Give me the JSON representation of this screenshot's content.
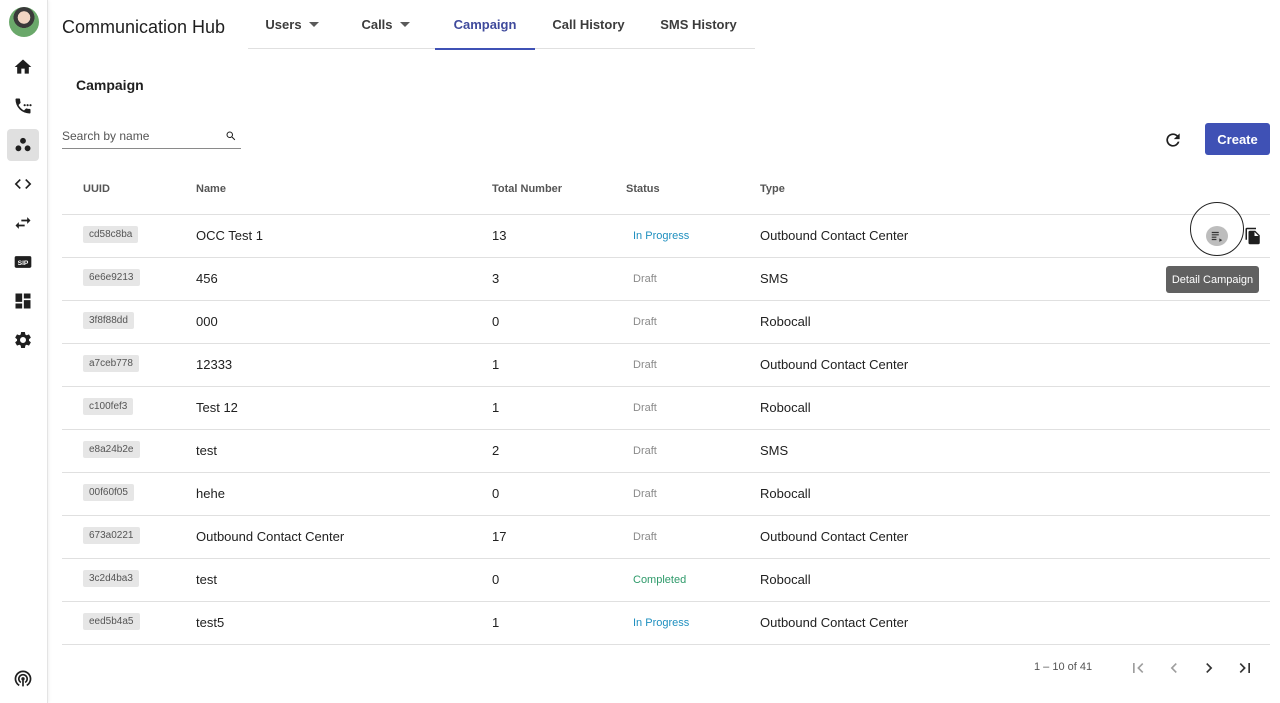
{
  "app": {
    "title": "Communication Hub"
  },
  "sidebar": {
    "items": [
      {
        "name": "home",
        "icon": "home-icon"
      },
      {
        "name": "calls",
        "icon": "phone-dial-icon"
      },
      {
        "name": "campaign",
        "icon": "group-icon",
        "active": true
      },
      {
        "name": "code",
        "icon": "code-icon"
      },
      {
        "name": "transfer",
        "icon": "swap-arrows-icon"
      },
      {
        "name": "sip",
        "icon": "sip-icon",
        "label": "SIP"
      },
      {
        "name": "dashboard",
        "icon": "dashboard-icon"
      },
      {
        "name": "settings",
        "icon": "gear-icon"
      },
      {
        "name": "podcast",
        "icon": "broadcast-icon"
      }
    ]
  },
  "tabs": [
    {
      "label": "Users",
      "dropdown": true
    },
    {
      "label": "Calls",
      "dropdown": true
    },
    {
      "label": "Campaign",
      "active": true
    },
    {
      "label": "Call History"
    },
    {
      "label": "SMS History"
    }
  ],
  "page": {
    "title": "Campaign"
  },
  "search": {
    "placeholder": "Search by name",
    "value": ""
  },
  "toolbar": {
    "create_label": "Create"
  },
  "table": {
    "headers": {
      "uuid": "UUID",
      "name": "Name",
      "total": "Total Number",
      "status": "Status",
      "type": "Type"
    },
    "rows": [
      {
        "uuid": "cd58c8ba",
        "name": "OCC Test 1",
        "total": "13",
        "status": "In Progress",
        "type": "Outbound Contact Center"
      },
      {
        "uuid": "6e6e9213",
        "name": "456",
        "total": "3",
        "status": "Draft",
        "type": "SMS"
      },
      {
        "uuid": "3f8f88dd",
        "name": "000",
        "total": "0",
        "status": "Draft",
        "type": "Robocall"
      },
      {
        "uuid": "a7ceb778",
        "name": "12333",
        "total": "1",
        "status": "Draft",
        "type": "Outbound Contact Center"
      },
      {
        "uuid": "c100fef3",
        "name": "Test 12",
        "total": "1",
        "status": "Draft",
        "type": "Robocall"
      },
      {
        "uuid": "e8a24b2e",
        "name": "test",
        "total": "2",
        "status": "Draft",
        "type": "SMS"
      },
      {
        "uuid": "00f60f05",
        "name": "hehe",
        "total": "0",
        "status": "Draft",
        "type": "Robocall"
      },
      {
        "uuid": "673a0221",
        "name": "Outbound Contact Center",
        "total": "17",
        "status": "Draft",
        "type": "Outbound Contact Center"
      },
      {
        "uuid": "3c2d4ba3",
        "name": "test",
        "total": "0",
        "status": "Completed",
        "type": "Robocall"
      },
      {
        "uuid": "eed5b4a5",
        "name": "test5",
        "total": "1",
        "status": "In Progress",
        "type": "Outbound Contact Center"
      }
    ]
  },
  "tooltip": {
    "text": "Detail Campaign"
  },
  "paginator": {
    "range": "1 – 10 of 41"
  },
  "colors": {
    "primary": "#3f51b5",
    "in_progress": "#1e8fbf",
    "draft": "#8a8a8a",
    "completed": "#2e9a6a"
  }
}
